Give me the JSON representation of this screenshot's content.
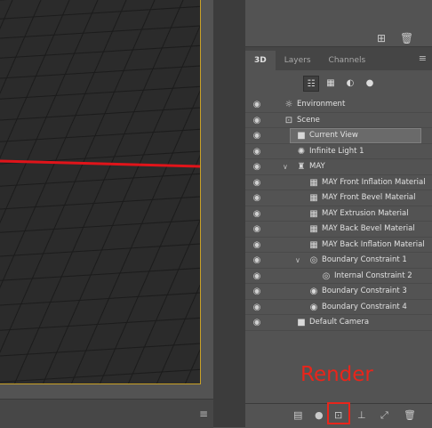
{
  "panel_tabs": [
    "3D",
    "Layers",
    "Channels"
  ],
  "layers": [
    {
      "label": "Environment",
      "icon": "environment-icon",
      "glyph": "☼",
      "selected": false
    },
    {
      "label": "Scene",
      "icon": "scene-icon",
      "glyph": "⊡",
      "selected": false
    },
    {
      "label": "Current View",
      "icon": "camera-icon",
      "glyph": "■",
      "selected": true
    },
    {
      "label": "Infinite Light 1",
      "icon": "light-icon",
      "glyph": "✺",
      "selected": false
    },
    {
      "label": "MAY",
      "icon": "mesh-icon",
      "glyph": "♜",
      "selected": false
    },
    {
      "label": "MAY Front Inflation Material",
      "icon": "material-icon",
      "glyph": "▦",
      "selected": false
    },
    {
      "label": "MAY Front Bevel Material",
      "icon": "material-icon",
      "glyph": "▦",
      "selected": false
    },
    {
      "label": "MAY Extrusion Material",
      "icon": "material-icon",
      "glyph": "▦",
      "selected": false
    },
    {
      "label": "MAY Back Bevel Material",
      "icon": "material-icon",
      "glyph": "▦",
      "selected": false
    },
    {
      "label": "MAY Back Inflation Material",
      "icon": "material-icon",
      "glyph": "▦",
      "selected": false
    },
    {
      "label": "Boundary Constraint 1",
      "icon": "constraint-icon",
      "glyph": "◎",
      "selected": false
    },
    {
      "label": "Internal Constraint 2",
      "icon": "constraint-icon",
      "glyph": "◎",
      "selected": false
    },
    {
      "label": "Boundary Constraint 3",
      "icon": "constraint-icon",
      "glyph": "◉",
      "selected": false
    },
    {
      "label": "Boundary Constraint 4",
      "icon": "constraint-icon",
      "glyph": "◉",
      "selected": false
    },
    {
      "label": "Default Camera",
      "icon": "camera-icon",
      "glyph": "■",
      "selected": false
    }
  ],
  "annotation": {
    "label": "Render",
    "color": "#e8251b"
  },
  "colors": {
    "accent_border": "#c9a227",
    "ground_line": "#e0141a"
  }
}
